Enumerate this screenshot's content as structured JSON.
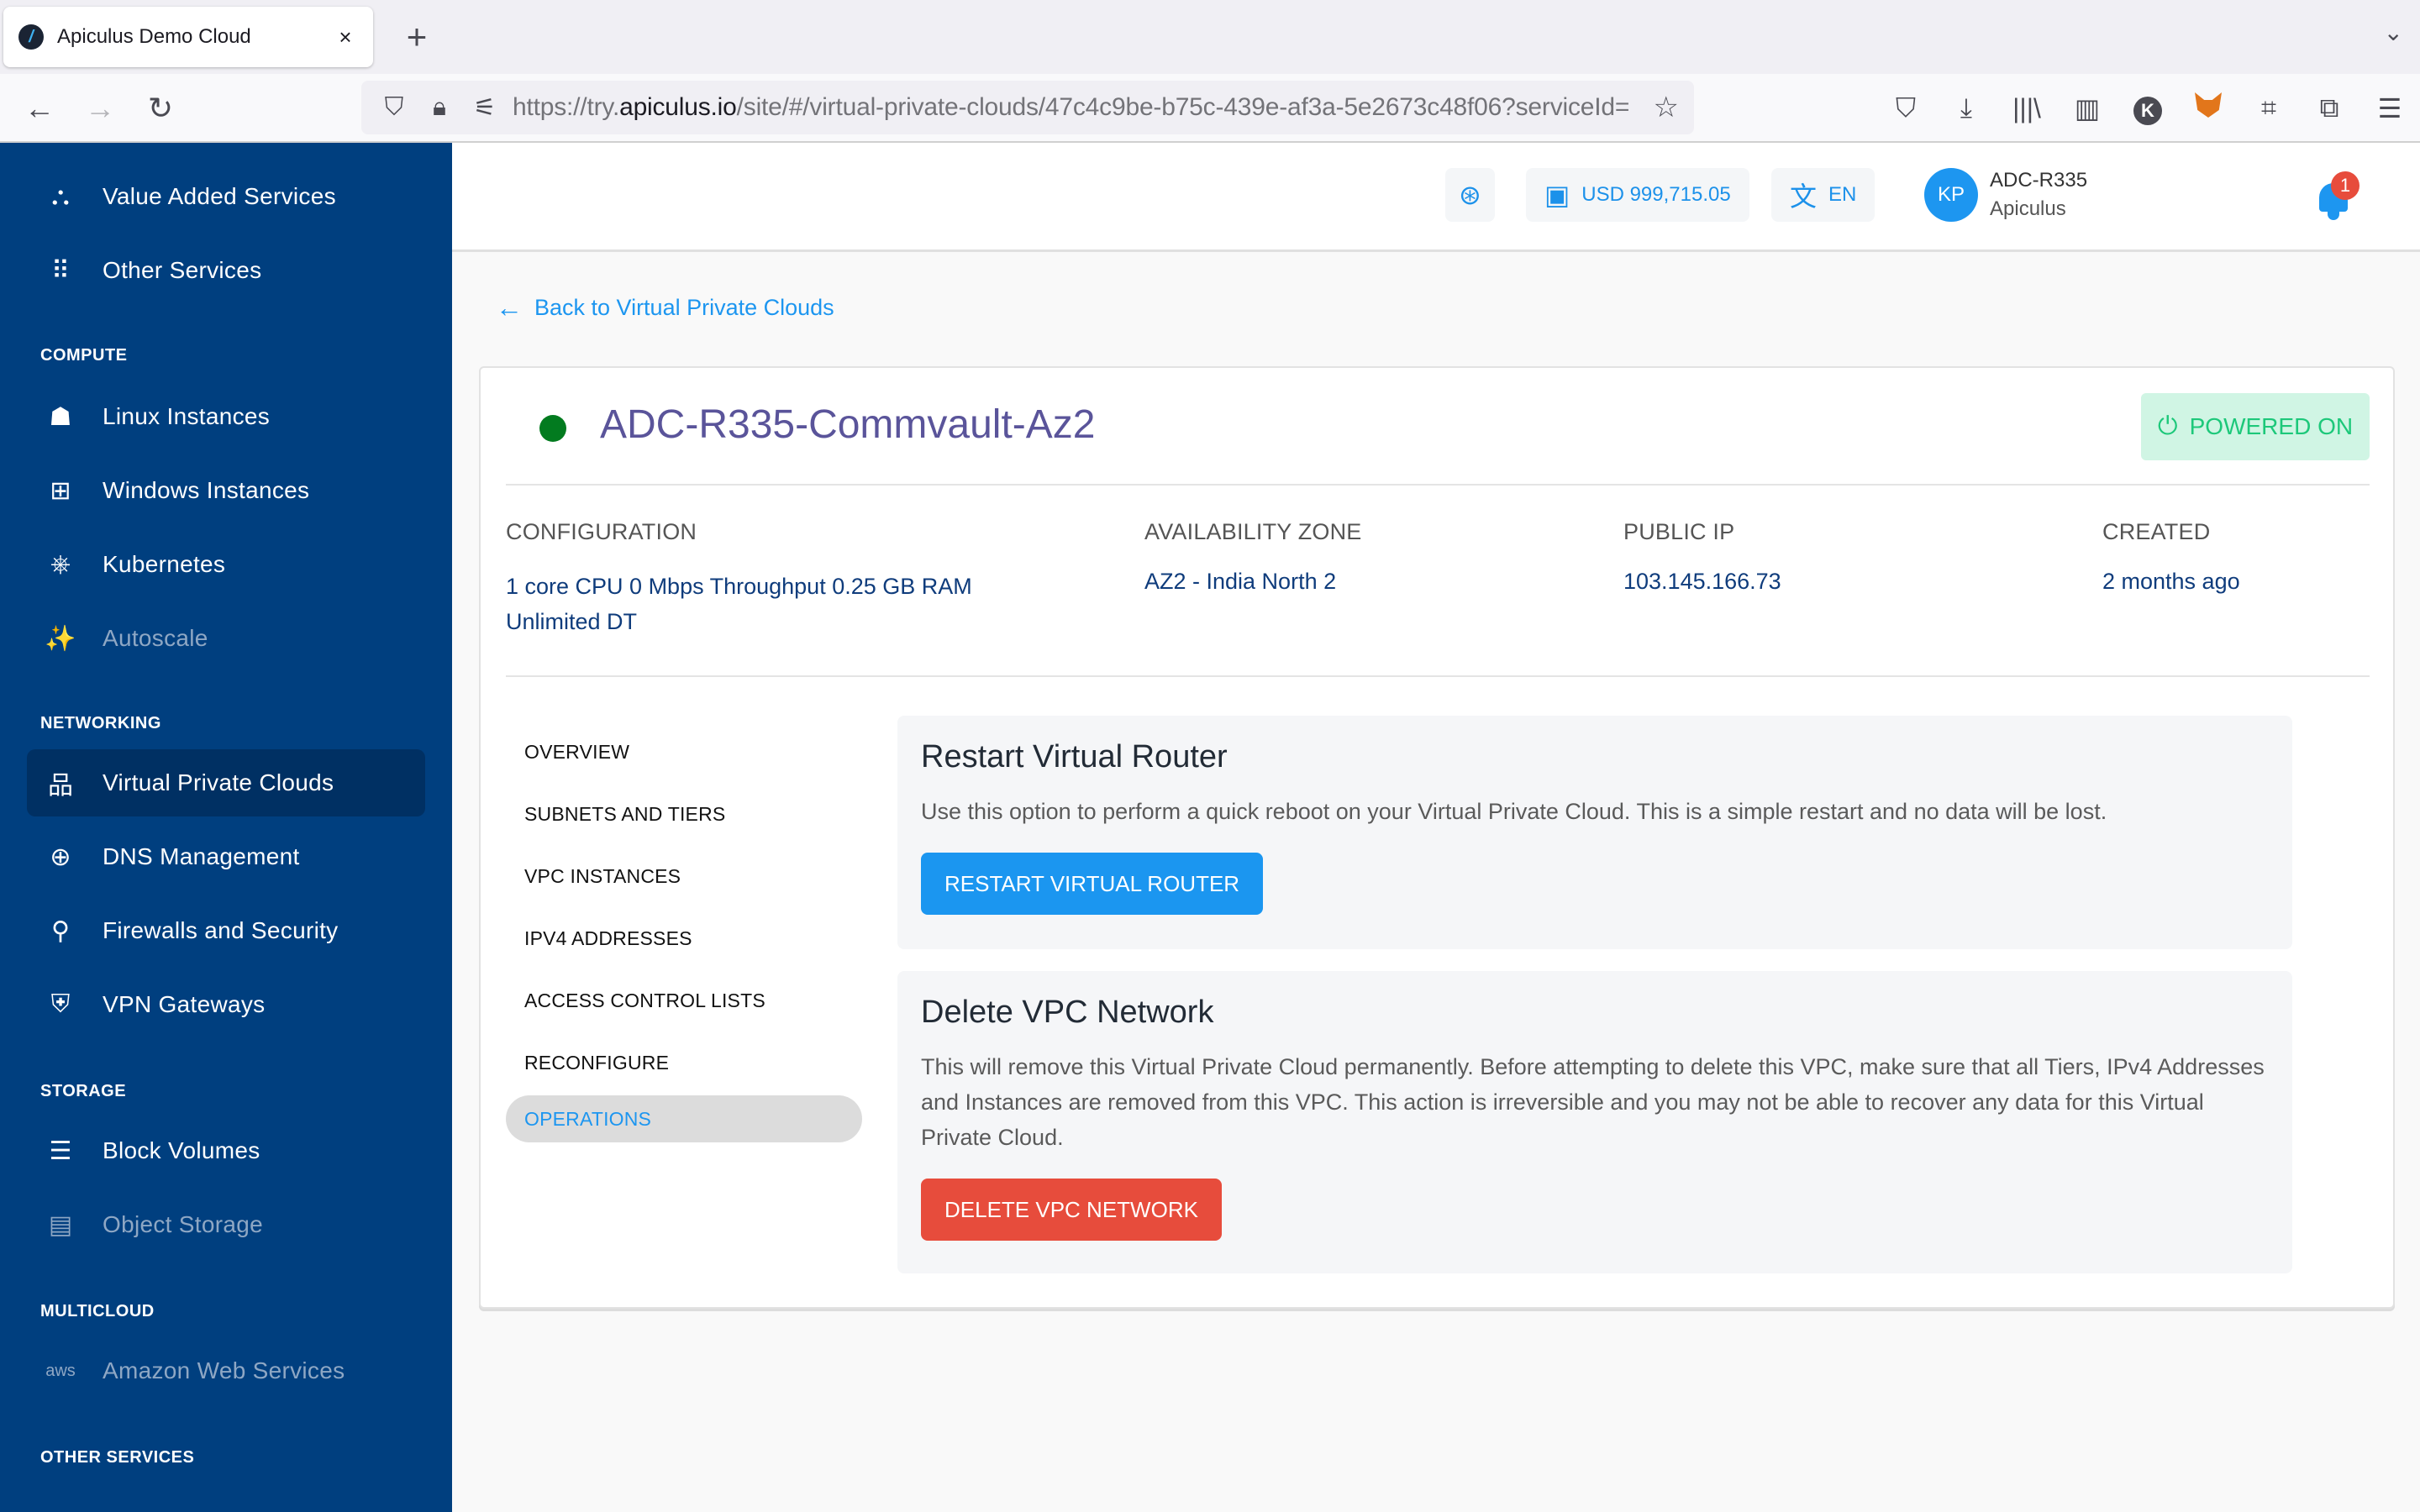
{
  "browser": {
    "tab_title": "Apiculus Demo Cloud",
    "tab_close": "×",
    "new_tab": "+",
    "tab_list": "⌄",
    "url_host_prefix": "https://try.",
    "url_host": "apiculus.io",
    "url_path": "/site/#/virtual-private-clouds/47c4c9be-b75c-439e-af3a-5e2673c48f06?serviceId=",
    "nav": {
      "back": "←",
      "forward": "→",
      "reload": "↻"
    },
    "toolbar_icons": [
      "pocket-icon",
      "download-icon",
      "library-icon",
      "sidebar-icon",
      "k-extension-icon",
      "metamask-icon",
      "crop-icon",
      "extensions-icon",
      "menu-icon"
    ]
  },
  "sidebar": {
    "items": [
      {
        "label": "Value Added Services",
        "icon": "shapes-icon",
        "glyph": "⛬",
        "state": "normal"
      },
      {
        "label": "Other Services",
        "icon": "grid-icon",
        "glyph": "⠿",
        "state": "normal"
      },
      {
        "section": "COMPUTE"
      },
      {
        "label": "Linux Instances",
        "icon": "linux-icon",
        "glyph": "☗",
        "state": "normal"
      },
      {
        "label": "Windows Instances",
        "icon": "windows-icon",
        "glyph": "⊞",
        "state": "normal"
      },
      {
        "label": "Kubernetes",
        "icon": "kubernetes-icon",
        "glyph": "⎈",
        "state": "normal"
      },
      {
        "label": "Autoscale",
        "icon": "magic-wand-icon",
        "glyph": "✨",
        "state": "muted"
      },
      {
        "section": "NETWORKING"
      },
      {
        "label": "Virtual Private Clouds",
        "icon": "network-icon",
        "glyph": "品",
        "state": "active"
      },
      {
        "label": "DNS Management",
        "icon": "globe-icon",
        "glyph": "⊕",
        "state": "normal"
      },
      {
        "label": "Firewalls and Security",
        "icon": "firewall-icon",
        "glyph": "⚲",
        "state": "normal"
      },
      {
        "label": "VPN Gateways",
        "icon": "shield-icon",
        "glyph": "⛨",
        "state": "normal"
      },
      {
        "section": "STORAGE"
      },
      {
        "label": "Block Volumes",
        "icon": "server-icon",
        "glyph": "☰",
        "state": "normal"
      },
      {
        "label": "Object Storage",
        "icon": "storage-icon",
        "glyph": "▤",
        "state": "muted"
      },
      {
        "section": "MULTICLOUD"
      },
      {
        "label": "Amazon Web Services",
        "icon": "aws-icon",
        "glyph": "aws",
        "state": "muted"
      },
      {
        "section": "OTHER SERVICES"
      }
    ]
  },
  "header": {
    "support_icon": "lifebuoy-icon",
    "balance": "USD 999,715.05",
    "language": "EN",
    "avatar_initials": "KP",
    "user_name": "ADC-R335",
    "user_org": "Apiculus",
    "notification_count": "1"
  },
  "main": {
    "back_link": "Back to Virtual Private Clouds",
    "vpc_name": "ADC-R335-Commvault-Az2",
    "status_color": "#027b1f",
    "power_state": "POWERED ON",
    "meta": [
      {
        "label": "CONFIGURATION",
        "value": "1 core CPU 0 Mbps Throughput 0.25 GB RAM Unlimited DT"
      },
      {
        "label": "AVAILABILITY ZONE",
        "value": "AZ2 - India North 2"
      },
      {
        "label": "PUBLIC IP",
        "value": "103.145.166.73"
      },
      {
        "label": "CREATED",
        "value": "2 months ago"
      }
    ],
    "tabs": [
      {
        "label": "OVERVIEW",
        "active": false
      },
      {
        "label": "SUBNETS AND TIERS",
        "active": false
      },
      {
        "label": "VPC INSTANCES",
        "active": false
      },
      {
        "label": "IPV4 ADDRESSES",
        "active": false
      },
      {
        "label": "ACCESS CONTROL LISTS",
        "active": false
      },
      {
        "label": "RECONFIGURE",
        "active": false
      },
      {
        "label": "OPERATIONS",
        "active": true
      }
    ],
    "restart": {
      "title": "Restart Virtual Router",
      "description": "Use this option to perform a quick reboot on your Virtual Private Cloud. This is a simple restart and no data will be lost.",
      "button": "RESTART VIRTUAL ROUTER"
    },
    "delete": {
      "title": "Delete VPC Network",
      "description": "This will remove this Virtual Private Cloud permanently. Before attempting to delete this VPC, make sure that all Tiers, IPv4 Addresses and Instances are removed from this VPC. This action is irreversible and you may not be able to recover any data for this Virtual Private Cloud.",
      "button": "DELETE VPC NETWORK"
    }
  },
  "colors": {
    "sidebar_bg": "#003f7f",
    "sidebar_active": "#003063",
    "accent_blue": "#1d96f0",
    "danger_red": "#e74c3c",
    "powered_bg": "#d0f5e4",
    "powered_fg": "#1dc87a",
    "vpc_name": "#5a549a",
    "meta_value": "#0f3c7c"
  }
}
